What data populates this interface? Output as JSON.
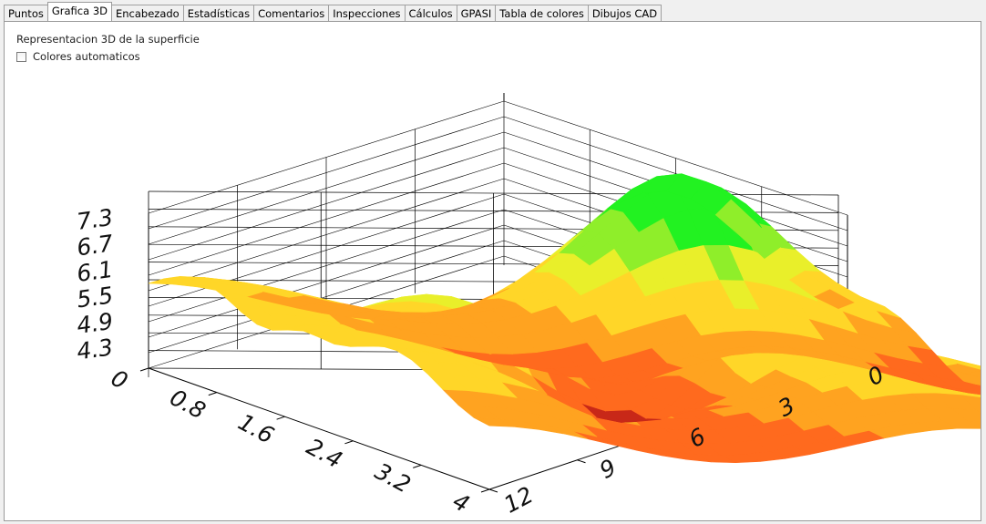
{
  "tabs": [
    {
      "label": "Puntos",
      "active": false
    },
    {
      "label": "Grafica 3D",
      "active": true
    },
    {
      "label": "Encabezado",
      "active": false
    },
    {
      "label": "Estadísticas",
      "active": false
    },
    {
      "label": "Comentarios",
      "active": false
    },
    {
      "label": "Inspecciones",
      "active": false
    },
    {
      "label": "Cálculos",
      "active": false
    },
    {
      "label": "GPASI",
      "active": false
    },
    {
      "label": "Tabla de colores",
      "active": false
    },
    {
      "label": "Dibujos CAD",
      "active": false
    }
  ],
  "panel": {
    "title": "Representacion 3D de la superficie",
    "auto_colors": {
      "label": "Colores automaticos",
      "checked": false
    }
  },
  "chart_data": {
    "type": "surface",
    "z_ticks": [
      "4.3",
      "4.9",
      "5.5",
      "6.1",
      "6.7",
      "7.3"
    ],
    "x_ticks": [
      "0",
      "0.8",
      "1.6",
      "2.4",
      "3.2",
      "4"
    ],
    "y_ticks": [
      "0",
      "3",
      "6",
      "9",
      "12"
    ],
    "zlim": [
      4.3,
      7.3
    ],
    "colormap": [
      "#c82818",
      "#ff6a1e",
      "#ffa320",
      "#ffd628",
      "#e9ef2a",
      "#8fee2a",
      "#22f221"
    ]
  }
}
